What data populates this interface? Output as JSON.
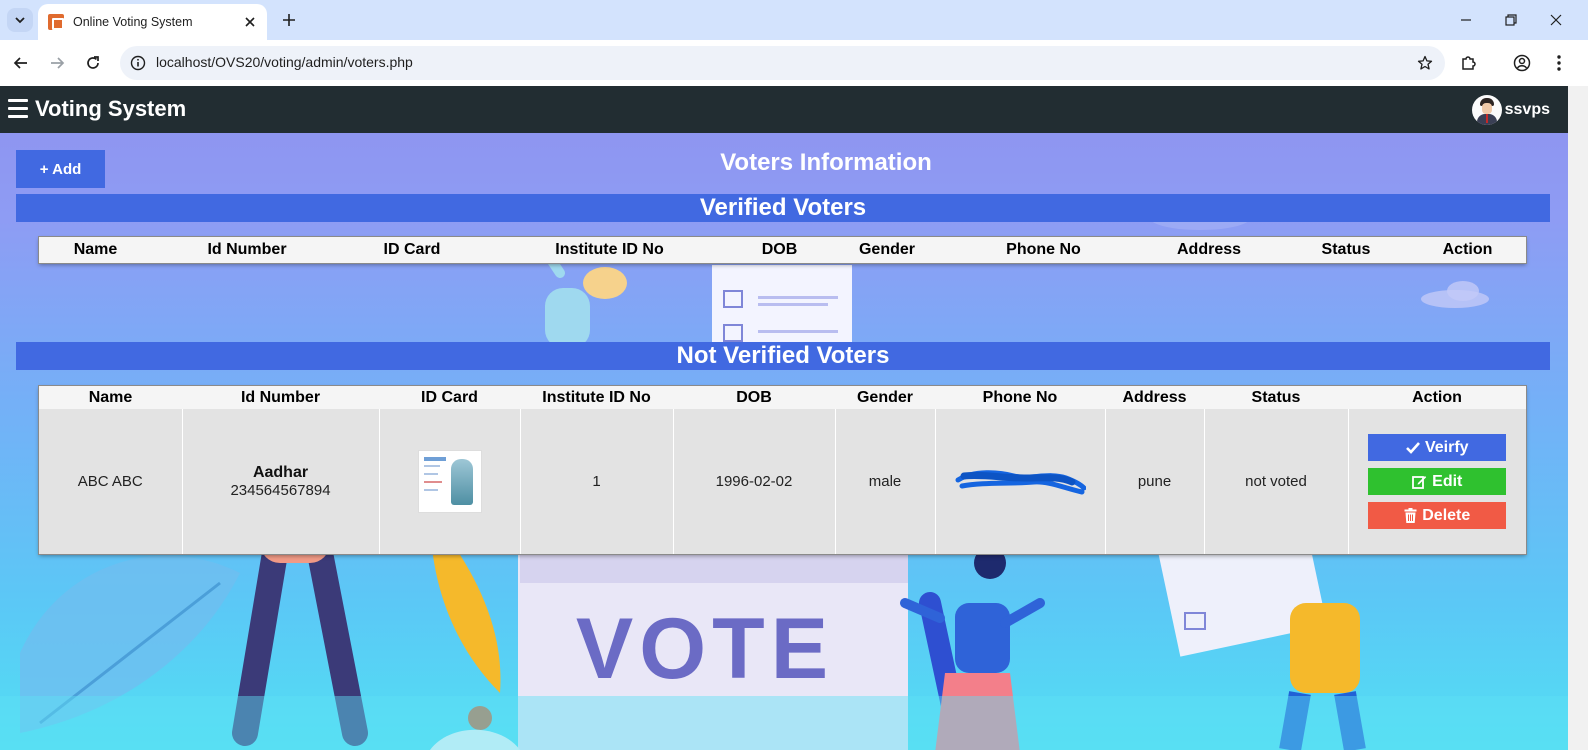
{
  "browser": {
    "tab_title": "Online Voting System",
    "url": "localhost/OVS20/voting/admin/voters.php"
  },
  "app": {
    "brand": "Voting System",
    "username": "ssvps"
  },
  "page": {
    "add_button": "+ Add",
    "title": "Voters Information",
    "verified_heading": "Verified Voters",
    "unverified_heading": "Not Verified Voters",
    "background_text": "VOTE"
  },
  "columns": [
    "Name",
    "Id Number",
    "ID Card",
    "Institute ID No",
    "DOB",
    "Gender",
    "Phone No",
    "Address",
    "Status",
    "Action"
  ],
  "verified_voters": [],
  "unverified_voters": [
    {
      "name": "ABC ABC",
      "id_type": "Aadhar",
      "id_number": "234564567894",
      "institute_id": "1",
      "dob": "1996-02-02",
      "gender": "male",
      "address": "pune",
      "status": "not voted"
    }
  ],
  "actions": {
    "verify": "Veirfy",
    "edit": "Edit",
    "delete": "Delete"
  },
  "colors": {
    "navbar": "#222d32",
    "primary": "#4169e1",
    "edit": "#2fc12f",
    "delete": "#f15a45"
  }
}
